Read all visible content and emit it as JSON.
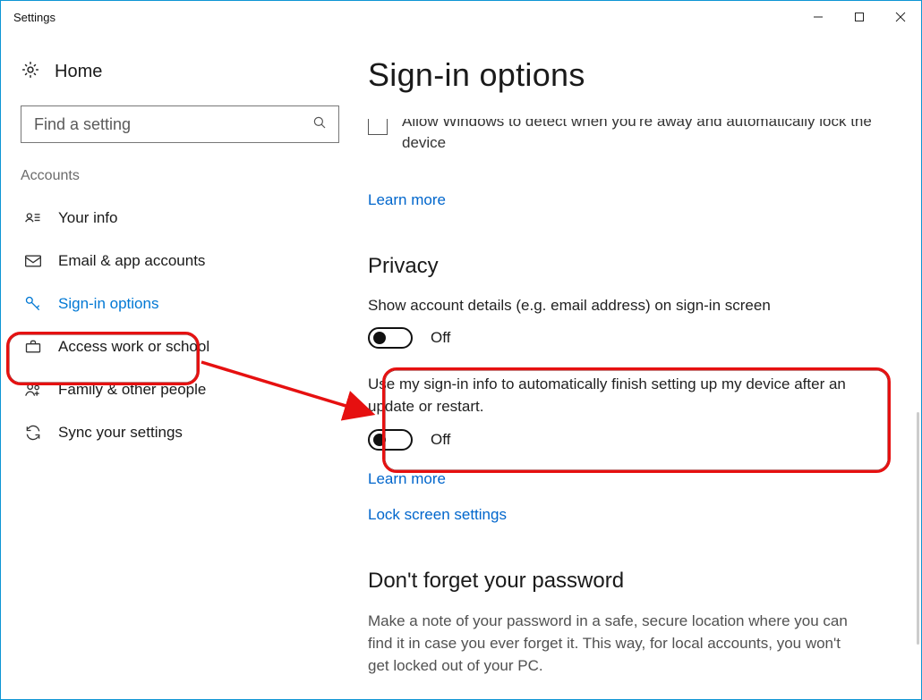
{
  "window_title": "Settings",
  "home_label": "Home",
  "search_placeholder": "Find a setting",
  "sidebar": {
    "category": "Accounts",
    "items": [
      {
        "label": "Your info"
      },
      {
        "label": "Email & app accounts"
      },
      {
        "label": "Sign-in options"
      },
      {
        "label": "Access work or school"
      },
      {
        "label": "Family & other people"
      },
      {
        "label": "Sync your settings"
      }
    ]
  },
  "page_title": "Sign-in options",
  "cutoff": {
    "text": "Allow Windows to detect when you're away and automatically lock the device",
    "link": "Learn more"
  },
  "privacy": {
    "heading": "Privacy",
    "item1": {
      "text": "Show account details (e.g. email address) on sign-in screen",
      "state": "Off"
    },
    "item2": {
      "text": "Use my sign-in info to automatically finish setting up my device after an update or restart.",
      "state": "Off"
    },
    "learn_more": "Learn more",
    "lock_link": "Lock screen settings"
  },
  "password": {
    "heading": "Don't forget your password",
    "text": "Make a note of your password in a safe, secure location where you can find it in case you ever forget it. This way, for local accounts, you won't get locked out of your PC."
  }
}
